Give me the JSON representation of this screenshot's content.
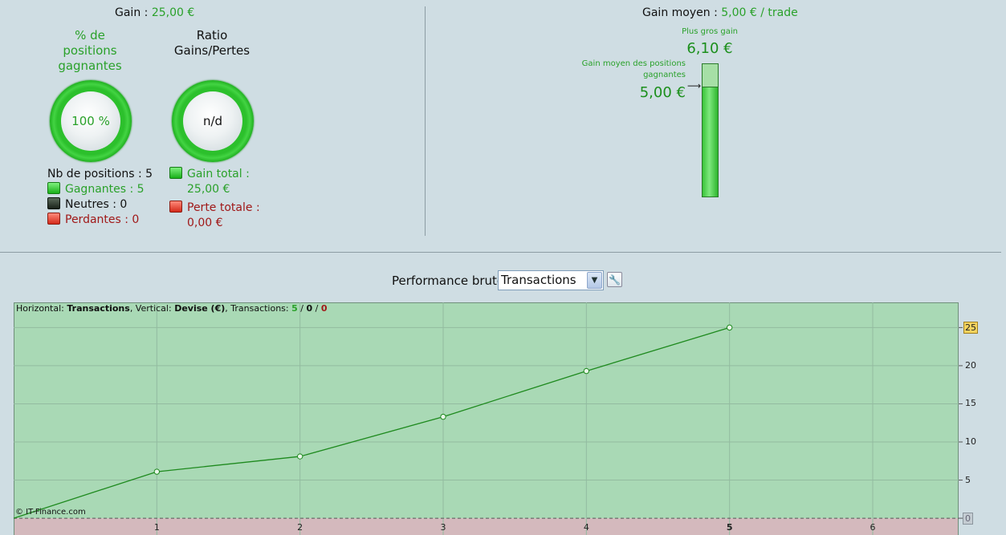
{
  "summary": {
    "gain_label": "Gain : ",
    "gain_value": "25,00 €",
    "pct_winning_label": "% de positions gagnantes",
    "pct_winning_value": "100 %",
    "ratio_label": "Ratio Gains/Pertes",
    "ratio_value": "n/d",
    "nb_positions": "Nb de positions : 5",
    "winning": "Gagnantes : 5",
    "neutral": "Neutres : 0",
    "losing": "Perdantes : 0",
    "gain_total_label": "Gain total :",
    "gain_total_value": "25,00 €",
    "perte_totale_label": "Perte totale :",
    "perte_totale_value": "0,00 €"
  },
  "average": {
    "label": "Gain moyen : ",
    "value": "5,00 € / trade",
    "biggest_label": "Plus gros gain",
    "biggest_value": "6,10 €",
    "avg_winning_label_1": "Gain moyen des positions",
    "avg_winning_label_2": "gagnantes",
    "avg_winning_value": "5,00 €",
    "avg_fraction_of_max": 0.82
  },
  "performance": {
    "title": "Performance brute",
    "select_value": "Transactions",
    "info_prefix": "Horizontal: ",
    "info_h": "Transactions",
    "info_mid": ", Vertical: ",
    "info_v": "Devise (€)",
    "info_tr": ", Transactions: ",
    "info_g": "5",
    "info_sep1": " / ",
    "info_n": "0",
    "info_sep2": " / ",
    "info_r": "0",
    "copyright": "© IT-Finance.com"
  },
  "colors": {
    "positive_area": "#a9d9b5",
    "negative_area": "#d4b9bd",
    "line": "#1e8a1e",
    "highlight_tick": "#f4d35e"
  },
  "chart_data": {
    "type": "line",
    "xlabel": "Transactions",
    "ylabel": "Devise (€)",
    "x": [
      0,
      1,
      2,
      3,
      4,
      5
    ],
    "values": [
      0,
      6.1,
      8.1,
      13.3,
      19.3,
      25.0
    ],
    "x_ticks": [
      1,
      2,
      3,
      4,
      5,
      6
    ],
    "y_ticks": [
      0,
      5,
      10,
      15,
      20,
      25
    ],
    "highlight_x": 5,
    "highlight_y": 25,
    "xlim": [
      0,
      6.6
    ],
    "ylim": [
      -2.2,
      28.3
    ],
    "grid": true
  }
}
